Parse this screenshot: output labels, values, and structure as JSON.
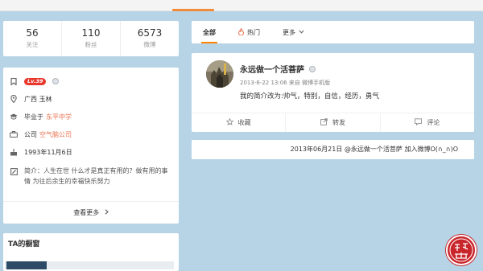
{
  "stats": [
    {
      "value": "56",
      "label": "关注"
    },
    {
      "value": "110",
      "label": "粉丝"
    },
    {
      "value": "6573",
      "label": "微博"
    }
  ],
  "profile": {
    "level": "Lv.39",
    "location": "广西 玉林",
    "school_prefix": "毕业于",
    "school": "东平中学",
    "company_prefix": "公司",
    "company": "空气脑公司",
    "birthday": "1993年11月6日",
    "bio": "简介：人生在世 什么才是真正有用的？做有用的事情 为往后余生的幸福快乐努力",
    "more_label": "查看更多"
  },
  "window": {
    "title": "TA的橱窗"
  },
  "tabs": [
    {
      "label": "全部",
      "active": true
    },
    {
      "label": "热门",
      "active": false
    },
    {
      "label": "更多",
      "active": false
    }
  ],
  "post": {
    "username": "永远做一个活菩萨",
    "meta": "2013-6-22 13:06 来自 微博手机版",
    "text": "我的简介改为:帅气，特别，自信，经历，勇气",
    "actions": [
      {
        "label": "收藏",
        "icon": "star-icon"
      },
      {
        "label": "转发",
        "icon": "share-icon"
      },
      {
        "label": "评论",
        "icon": "comment-icon"
      }
    ]
  },
  "join": {
    "text": "2013年06月21日 @永远做一个活菩萨 加入微博O(∩_∩)O"
  },
  "colors": {
    "accent": "#ff8200",
    "link": "#eb7350",
    "badge": "#e8382d",
    "background": "#b7d4e6",
    "seal": "#c9262c"
  }
}
